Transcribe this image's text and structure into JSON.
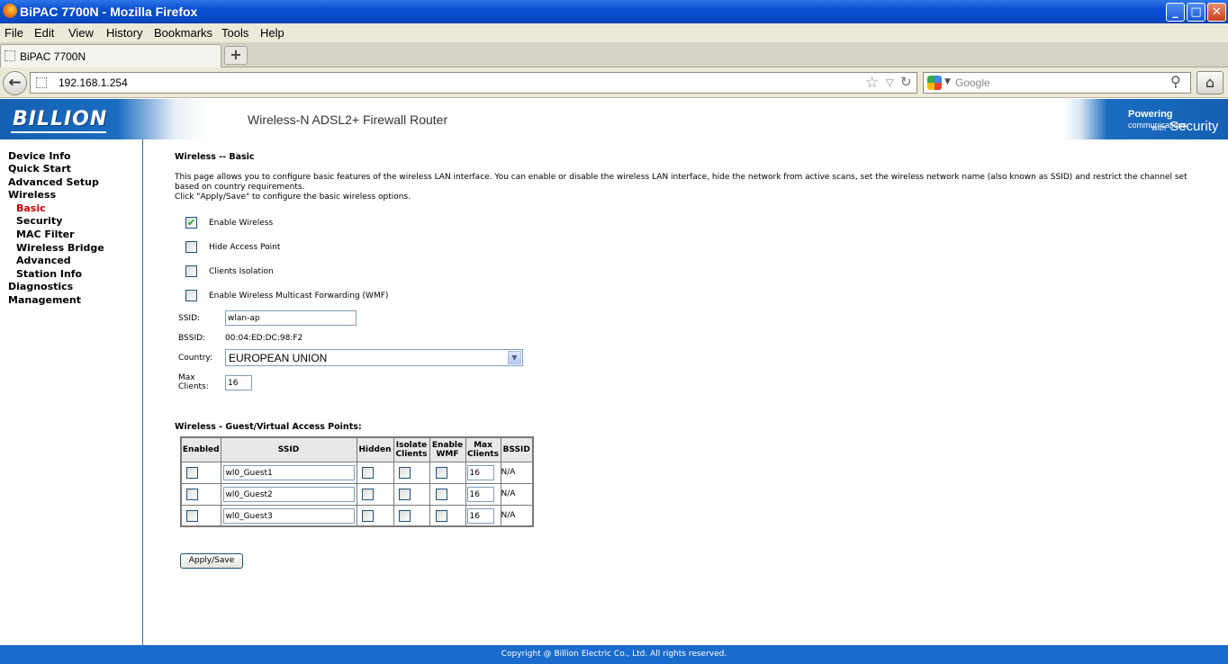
{
  "window": {
    "title": "BiPAC 7700N - Mozilla Firefox",
    "buttons": {
      "minimize": "_",
      "maximize": "□",
      "close": "✕"
    }
  },
  "menu": [
    "File",
    "Edit",
    "View",
    "History",
    "Bookmarks",
    "Tools",
    "Help"
  ],
  "tab": {
    "label": "BiPAC 7700N",
    "new_tab": "+"
  },
  "nav": {
    "back": "←",
    "url": "192.168.1.254",
    "search_placeholder": "Google",
    "home": "⌂"
  },
  "banner": {
    "brand": "BILLION",
    "title": "Wireless-N ADSL2+ Firewall Router",
    "tag_powering": "Powering",
    "tag_communications": "communications",
    "tag_with": "with",
    "tag_security": "Security"
  },
  "sidebar": {
    "items": [
      {
        "label": "Device Info",
        "level": 0
      },
      {
        "label": "Quick Start",
        "level": 0
      },
      {
        "label": "Advanced Setup",
        "level": 0
      },
      {
        "label": "Wireless",
        "level": 0
      },
      {
        "label": "Basic",
        "level": 1,
        "active": true
      },
      {
        "label": "Security",
        "level": 1
      },
      {
        "label": "MAC Filter",
        "level": 1
      },
      {
        "label": "Wireless Bridge",
        "level": 1
      },
      {
        "label": "Advanced",
        "level": 1
      },
      {
        "label": "Station Info",
        "level": 1
      },
      {
        "label": "Diagnostics",
        "level": 0
      },
      {
        "label": "Management",
        "level": 0
      }
    ]
  },
  "page": {
    "heading": "Wireless -- Basic",
    "description_1": "This page allows you to configure basic features of the wireless LAN interface. You can enable or disable the wireless LAN interface, hide the network from active scans, set the wireless network name (also known as SSID) and restrict the channel set based on country requirements.",
    "description_2": "Click \"Apply/Save\" to configure the basic wireless options.",
    "options": [
      {
        "label": "Enable Wireless",
        "checked": true
      },
      {
        "label": "Hide Access Point",
        "checked": false
      },
      {
        "label": "Clients Isolation",
        "checked": false
      },
      {
        "label": "Enable Wireless Multicast Forwarding (WMF)",
        "checked": false
      }
    ],
    "ssid_label": "SSID:",
    "ssid_value": "wlan-ap",
    "bssid_label": "BSSID:",
    "bssid_value": "00:04:ED:DC:98:F2",
    "country_label": "Country:",
    "country_value": "EUROPEAN UNION",
    "max_clients_label_1": "Max",
    "max_clients_label_2": "Clients:",
    "max_clients_value": "16",
    "guest_heading": "Wireless - Guest/Virtual Access Points:",
    "guest_columns": [
      "Enabled",
      "SSID",
      "Hidden",
      "Isolate Clients",
      "Enable WMF",
      "Max Clients",
      "BSSID"
    ],
    "guest_rows": [
      {
        "enabled": false,
        "ssid": "wl0_Guest1",
        "hidden": false,
        "isolate": false,
        "wmf": false,
        "max": "16",
        "bssid": "N/A"
      },
      {
        "enabled": false,
        "ssid": "wl0_Guest2",
        "hidden": false,
        "isolate": false,
        "wmf": false,
        "max": "16",
        "bssid": "N/A"
      },
      {
        "enabled": false,
        "ssid": "wl0_Guest3",
        "hidden": false,
        "isolate": false,
        "wmf": false,
        "max": "16",
        "bssid": "N/A"
      }
    ],
    "apply_label": "Apply/Save"
  },
  "footer": "Copyright @ Billion Electric Co., Ltd. All rights reserved.",
  "colors": {
    "titlebar": "#0a4fd0",
    "brand_blue": "#1a6ccc",
    "active_nav": "#cc0000",
    "check": "#21a121"
  }
}
